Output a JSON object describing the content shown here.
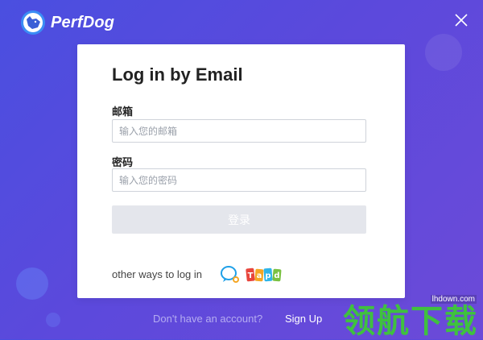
{
  "app": {
    "brand_name": "PerfDog"
  },
  "login": {
    "title": "Log in by Email",
    "email_label": "邮箱",
    "email_placeholder": "输入您的邮箱",
    "password_label": "密码",
    "password_placeholder": "输入您的密码",
    "submit_label": "登录",
    "other_ways_label": "other ways to log in",
    "providers": [
      "qq-icon",
      "tapd-logo"
    ]
  },
  "footer": {
    "question": "Don't have an account?",
    "signup_label": "Sign Up"
  },
  "watermark": {
    "url": "lhdown.com",
    "text": "领航下载"
  },
  "colors": {
    "background_start": "#4a4fe0",
    "background_end": "#6c4ad8",
    "button_disabled": "#e4e6ec",
    "watermark_green": "#3fc13f"
  }
}
